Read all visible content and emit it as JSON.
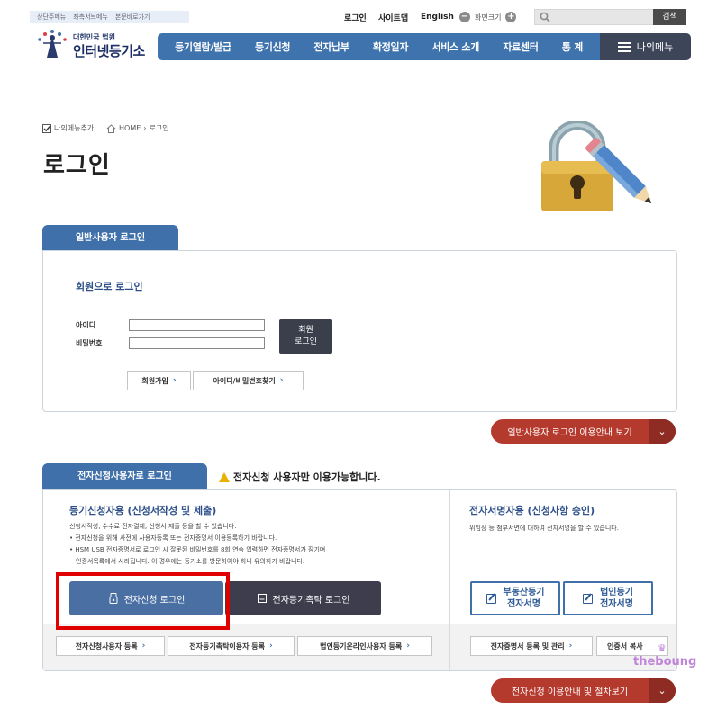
{
  "skip_links": [
    "상단주메뉴",
    "좌측서브메뉴",
    "본문바로가기"
  ],
  "utility": {
    "login": "로그인",
    "sitemap": "사이트맵",
    "english": "English",
    "zoom_label": "화면크기",
    "zoom_out": "−",
    "zoom_in": "+",
    "search_placeholder": "",
    "search_button": "검색"
  },
  "logo": {
    "org": "대한민국 법원",
    "name": "인터넷등기소"
  },
  "gnb": {
    "items": [
      "등기열람/발급",
      "등기신청",
      "전자납부",
      "확정일자",
      "서비스 소개",
      "자료센터",
      "통 계"
    ],
    "my_menu": "나의메뉴"
  },
  "breadcrumb": {
    "add_menu": "나의메뉴추가",
    "home": "HOME",
    "separator": "›",
    "current": "로그인"
  },
  "page_title": "로그인",
  "general_login": {
    "tab": "일반사용자 로그인",
    "section_title": "회원으로 로그인",
    "id_label": "아이디",
    "pw_label": "비밀번호",
    "id_value": "",
    "pw_value": "",
    "login_button": [
      "회원",
      "로그인"
    ],
    "signup": "회원가입",
    "find_account": "아이디/비밀번호찾기",
    "guide_button": "일반사용자 로그인 이용안내 보기"
  },
  "efile_login": {
    "tab": "전자신청사용자로 로그인",
    "notice": "전자신청 사용자만 이용가능합니다.",
    "left": {
      "title": "등기신청자용 (신청서작성 및 제출)",
      "desc1": "신청서작성, 수수료 전자결제, 신청서 제출 등을 할 수 있습니다.",
      "bullet1": "• 전자신청을 위해 사전에 사용자등록 또는 전자증명서 이용등록하기 바랍니다.",
      "bullet2a": "• HSM USB 전자증명서로 로그인 시 잘못된 비밀번호를 8회 연속 입력하면 전자증명서가 잠기며",
      "bullet2b": "인증서목록에서 사라집니다. 이 경우에는 등기소를 방문하여야 하니 유의하기 바랍니다.",
      "btn_efile": "전자신청 로그인",
      "btn_trust": "전자등기촉탁 로그인",
      "reg_buttons": [
        "전자신청사용자 등록",
        "전자등기촉탁이용자 등록",
        "법인등기온라인사용자 등록"
      ]
    },
    "right": {
      "title": "전자서명자용 (신청사항 승인)",
      "desc": "위임장 등 첨부서면에 대하여 전자서명을 할 수 있습니다.",
      "btn_realty": [
        "부동산등기",
        "전자서명"
      ],
      "btn_corp": [
        "법인등기",
        "전자서명"
      ],
      "reg_buttons": [
        "전자증명서 등록 및 관리",
        "인증서 복사"
      ]
    },
    "guide_button": "전자신청 이용안내 및 절차보기"
  },
  "watermark": "theboung",
  "colors": {
    "primary": "#3f70aa",
    "dark": "#3d4659",
    "accent_red": "#b53a2e",
    "highlight": "#e00000"
  }
}
